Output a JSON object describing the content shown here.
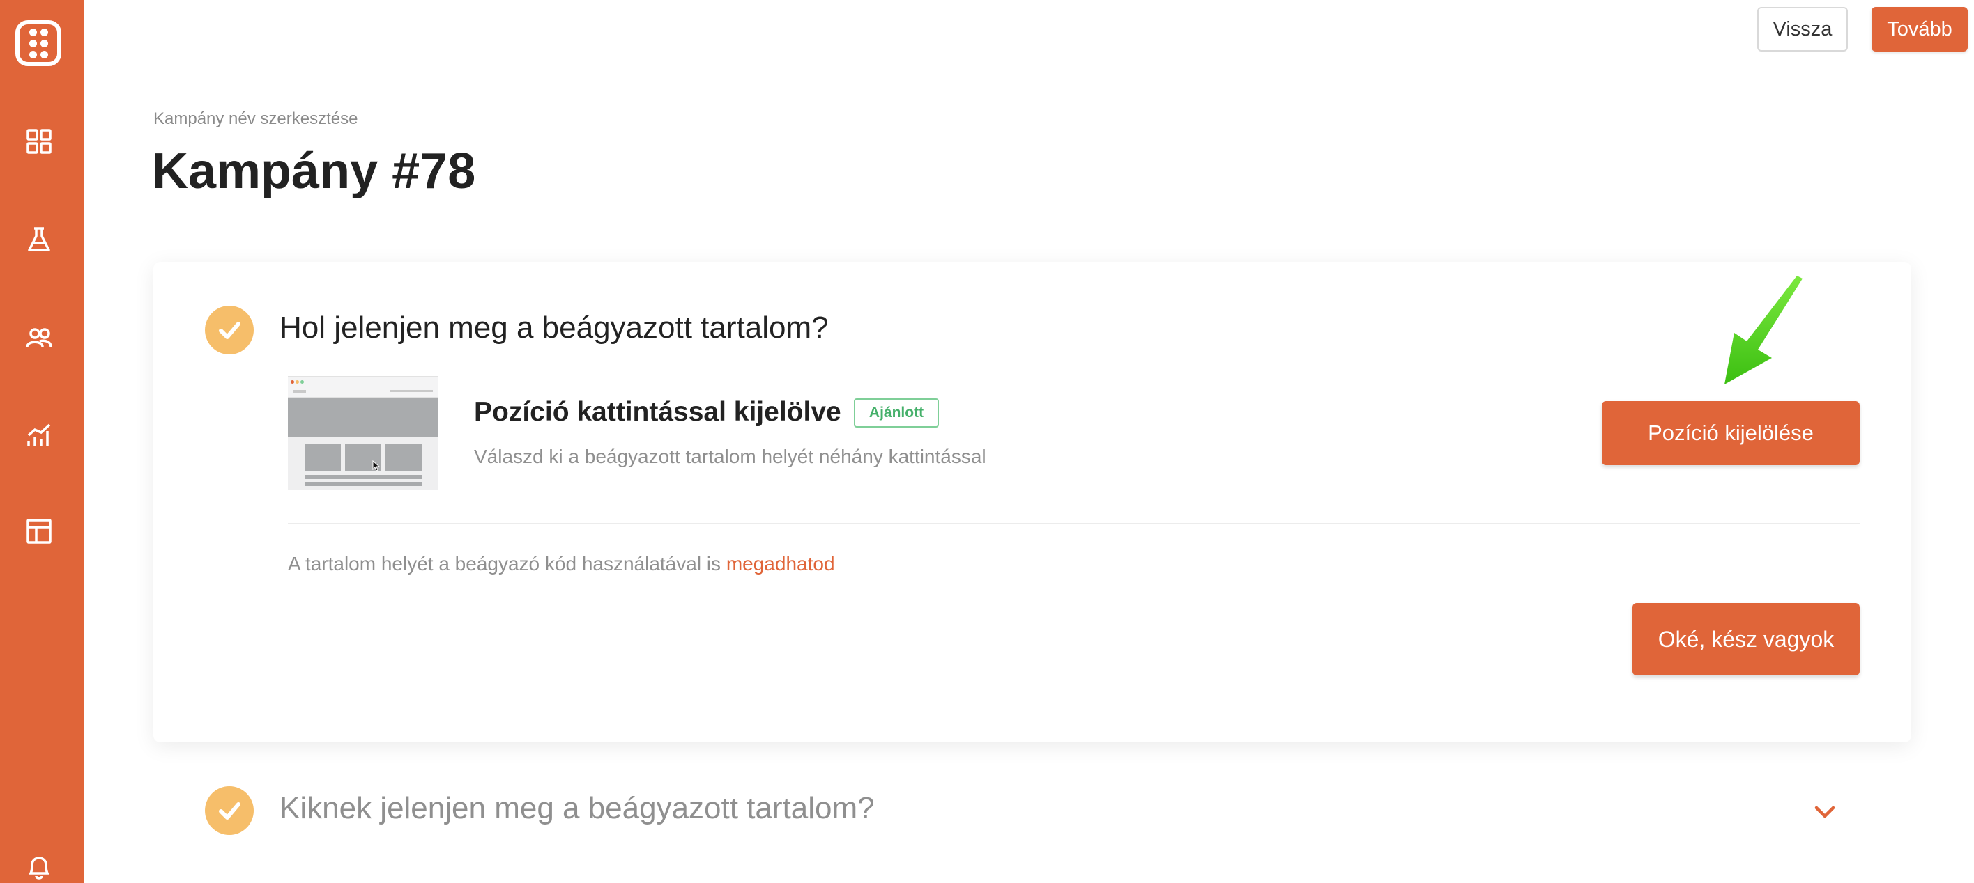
{
  "top_actions": {
    "back_label": "Vissza",
    "next_label": "Tovább"
  },
  "sidebar": {
    "items": [
      {
        "icon": "dashboard-grid-icon"
      },
      {
        "icon": "flask-icon"
      },
      {
        "icon": "users-icon"
      },
      {
        "icon": "analytics-chart-icon"
      },
      {
        "icon": "layout-template-icon"
      },
      {
        "icon": "bell-icon"
      }
    ]
  },
  "header": {
    "breadcrumb": "Kampány név szerkesztése",
    "title": "Kampány #78"
  },
  "placement_section": {
    "title": "Hol jelenjen meg a beágyazott tartalom?",
    "option": {
      "title": "Pozíció kattintással kijelölve",
      "badge": "Ajánlott",
      "description": "Válaszd ki a beágyazott tartalom helyét néhány kattintással",
      "button_label": "Pozíció kijelölése"
    },
    "embed_note": "A tartalom helyét a beágyazó kód használatával is",
    "embed_link": "megadhatod",
    "done_label": "Oké, kész vagyok"
  },
  "audience_section": {
    "title": "Kiknek jelenjen meg a beágyazott tartalom?"
  },
  "colors": {
    "accent": "#e06539",
    "check": "#f6be6a",
    "badge": "#45b06a",
    "highlight_arrow": "#4cd11c"
  }
}
